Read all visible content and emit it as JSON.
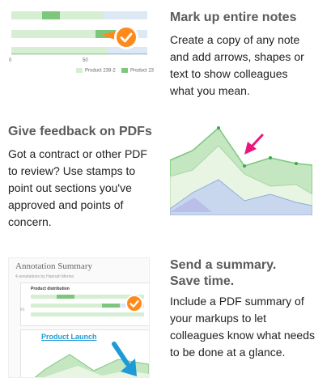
{
  "features": [
    {
      "title": "Mark up entire notes",
      "body_lines": [
        "Create a copy of any note",
        "and add arrows, shapes or",
        "text to show colleagues",
        "what you mean."
      ]
    },
    {
      "title": "Give feedback on PDFs",
      "body_lines": [
        "Got a contract or other PDF",
        "to review? Use stamps to",
        "point out sections you've",
        "approved and points of",
        "concern."
      ]
    },
    {
      "title_lines": [
        "Send a summary.",
        "Save time."
      ],
      "body_lines": [
        "Include a PDF summary of",
        "your markups to let",
        "colleagues know what needs",
        "to be done at a glance."
      ]
    }
  ],
  "bar_chart_preview": {
    "tick_labels": [
      "0",
      "50"
    ],
    "legend": [
      "Product 238-2",
      "Product 23"
    ]
  },
  "summary_preview": {
    "title": "Annotation Summary",
    "subtitle": "4 annotations by Hannah Merino",
    "card_title": "Product distribution",
    "page_number": "#1",
    "callout": "Product Launch"
  },
  "colors": {
    "green_dark": "#7dc77d",
    "green_light": "#d6efd3",
    "blue_light": "#dce8f4",
    "orange": "#ff8a1c",
    "magenta": "#e8177d",
    "cyan": "#1e9bd7"
  },
  "icons": [
    "checkmark-icon",
    "arrow-annotation-icon"
  ]
}
